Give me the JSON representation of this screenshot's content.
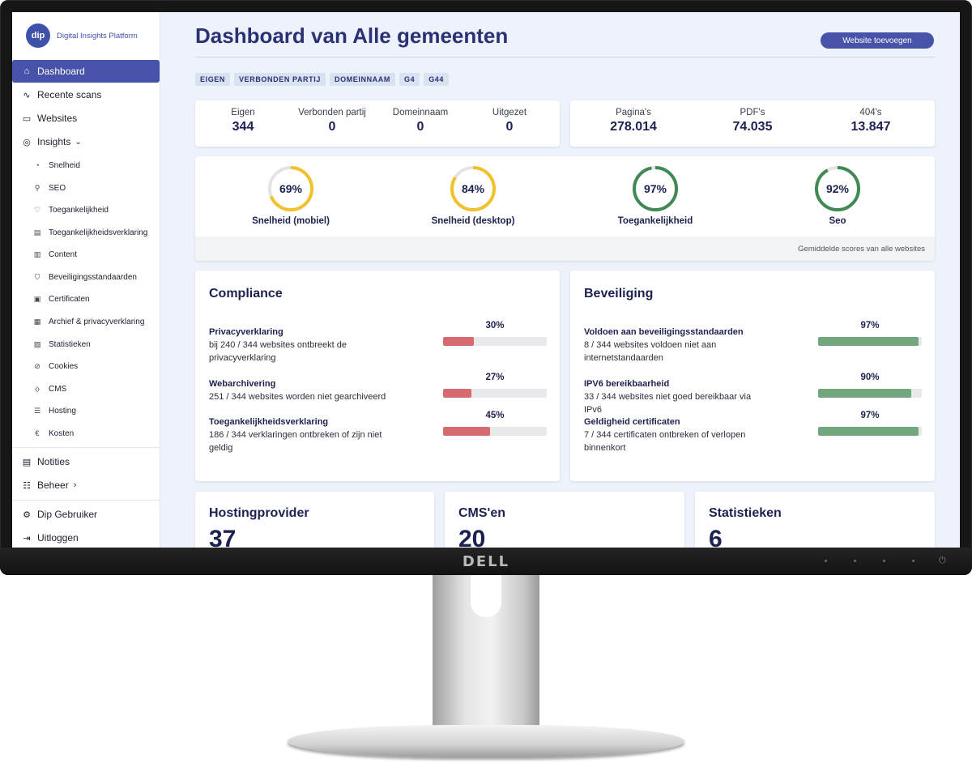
{
  "brand": {
    "mark": "dip",
    "name": "Digital Insights Platform"
  },
  "sidebar": {
    "main_top": [
      {
        "label": "Dashboard",
        "icon": "home-icon",
        "active": true
      },
      {
        "label": "Recente scans",
        "icon": "activity-icon"
      },
      {
        "label": "Websites",
        "icon": "browser-window-icon"
      },
      {
        "label": "Insights",
        "icon": "insights-icon",
        "chevron": "chevron-down-icon"
      }
    ],
    "insights_items": [
      {
        "label": "Snelheid",
        "icon": "speedometer-icon"
      },
      {
        "label": "SEO",
        "icon": "search-icon"
      },
      {
        "label": "Toegankelijkheid",
        "icon": "heart-icon"
      },
      {
        "label": "Toegankelijkheidsverklaring",
        "icon": "clipboard-icon"
      },
      {
        "label": "Content",
        "icon": "document-icon"
      },
      {
        "label": "Beveiligingsstandaarden",
        "icon": "shield-icon"
      },
      {
        "label": "Certificaten",
        "icon": "certificate-icon"
      },
      {
        "label": "Archief & privacyverklaring",
        "icon": "archive-icon"
      },
      {
        "label": "Statistieken",
        "icon": "chart-icon"
      },
      {
        "label": "Cookies",
        "icon": "cookie-icon"
      },
      {
        "label": "CMS",
        "icon": "code-icon"
      },
      {
        "label": "Hosting",
        "icon": "server-icon"
      },
      {
        "label": "Kosten",
        "icon": "euro-icon"
      }
    ],
    "notities": {
      "label": "Notities",
      "icon": "notes-icon"
    },
    "beheer": {
      "label": "Beheer",
      "icon": "sliders-icon"
    },
    "user": {
      "label": "Dip Gebruiker",
      "icon": "gear-icon"
    },
    "logout": {
      "label": "Uitloggen",
      "icon": "logout-icon"
    }
  },
  "header": {
    "title": "Dashboard van Alle gemeenten",
    "add_button": "Website toevoegen"
  },
  "tags": [
    "EIGEN",
    "VERBONDEN PARTIJ",
    "DOMEINNAAM",
    "G4",
    "G44"
  ],
  "site_counts": [
    {
      "label": "Eigen",
      "value": "344"
    },
    {
      "label": "Verbonden partij",
      "value": "0"
    },
    {
      "label": "Domeinnaam",
      "value": "0"
    },
    {
      "label": "Uitgezet",
      "value": "0"
    }
  ],
  "page_counts": [
    {
      "label": "Pagina's",
      "value": "278.014"
    },
    {
      "label": "PDF's",
      "value": "74.035"
    },
    {
      "label": "404's",
      "value": "13.847"
    }
  ],
  "scores": {
    "items": [
      {
        "label": "Snelheid (mobiel)",
        "percent_text": "69%",
        "value": 69,
        "color": "#f2c12e"
      },
      {
        "label": "Snelheid (desktop)",
        "percent_text": "84%",
        "value": 84,
        "color": "#f2c12e"
      },
      {
        "label": "Toegankelijkheid",
        "percent_text": "97%",
        "value": 97,
        "color": "#3e8a52"
      },
      {
        "label": "Seo",
        "percent_text": "92%",
        "value": 92,
        "color": "#3e8a52"
      }
    ],
    "footer": "Gemiddelde scores van alle websites"
  },
  "compliance": {
    "title": "Compliance",
    "items": [
      {
        "name": "Privacyverklaring",
        "desc": "bij 240 / 344 websites ontbreekt de privacyverklaring",
        "percent_text": "30%",
        "value": 30
      },
      {
        "name": "Webarchivering",
        "desc": "251 / 344 websites worden niet gearchiveerd",
        "percent_text": "27%",
        "value": 27
      },
      {
        "name": "Toegankelijkheidsverklaring",
        "desc": "186 / 344 verklaringen ontbreken of zijn niet geldig",
        "percent_text": "45%",
        "value": 45
      }
    ],
    "bar_color": "#d66b6f"
  },
  "security": {
    "title": "Beveiliging",
    "items": [
      {
        "name": "Voldoen aan beveiligingsstandaarden",
        "desc": "8 / 344 websites voldoen niet aan internetstandaarden",
        "percent_text": "97%",
        "value": 97
      },
      {
        "name": "IPV6 bereikbaarheid",
        "desc": "33 / 344 websites niet goed bereikbaar via IPv6",
        "percent_text": "90%",
        "value": 90
      },
      {
        "name": "Geldigheid certificaten",
        "desc": "7 / 344 certificaten ontbreken of verlopen binnenkort",
        "percent_text": "97%",
        "value": 97
      }
    ],
    "bar_color": "#72a67d"
  },
  "bottom_cards": [
    {
      "title": "Hostingprovider",
      "number": "37"
    },
    {
      "title": "CMS'en",
      "number": "20"
    },
    {
      "title": "Statistieken",
      "number": "6"
    }
  ],
  "monitor": {
    "logo": "DELL",
    "power_icon": "power-icon"
  }
}
